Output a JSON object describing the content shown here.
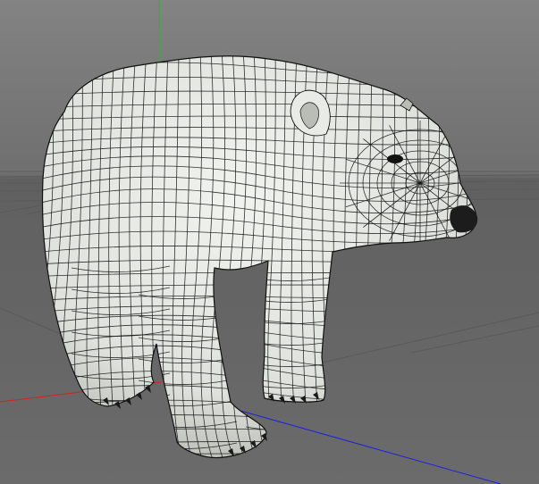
{
  "viewport": {
    "background_color": "#7b7b7b",
    "horizon_color": "#5e5e5e",
    "grid_line_color": "#5a5a5a",
    "axis_colors": {
      "x": "#d82020",
      "y": "#28b828",
      "z": "#2020e0"
    }
  },
  "model": {
    "name": "polar-bear-mesh",
    "surface_color": "#e9ece6",
    "shade_color": "#b9bdb5",
    "wire_color": "#101010",
    "claw_color": "#1a1a1a",
    "eye_color": "#121212",
    "nose_color": "#1c1c1c"
  }
}
